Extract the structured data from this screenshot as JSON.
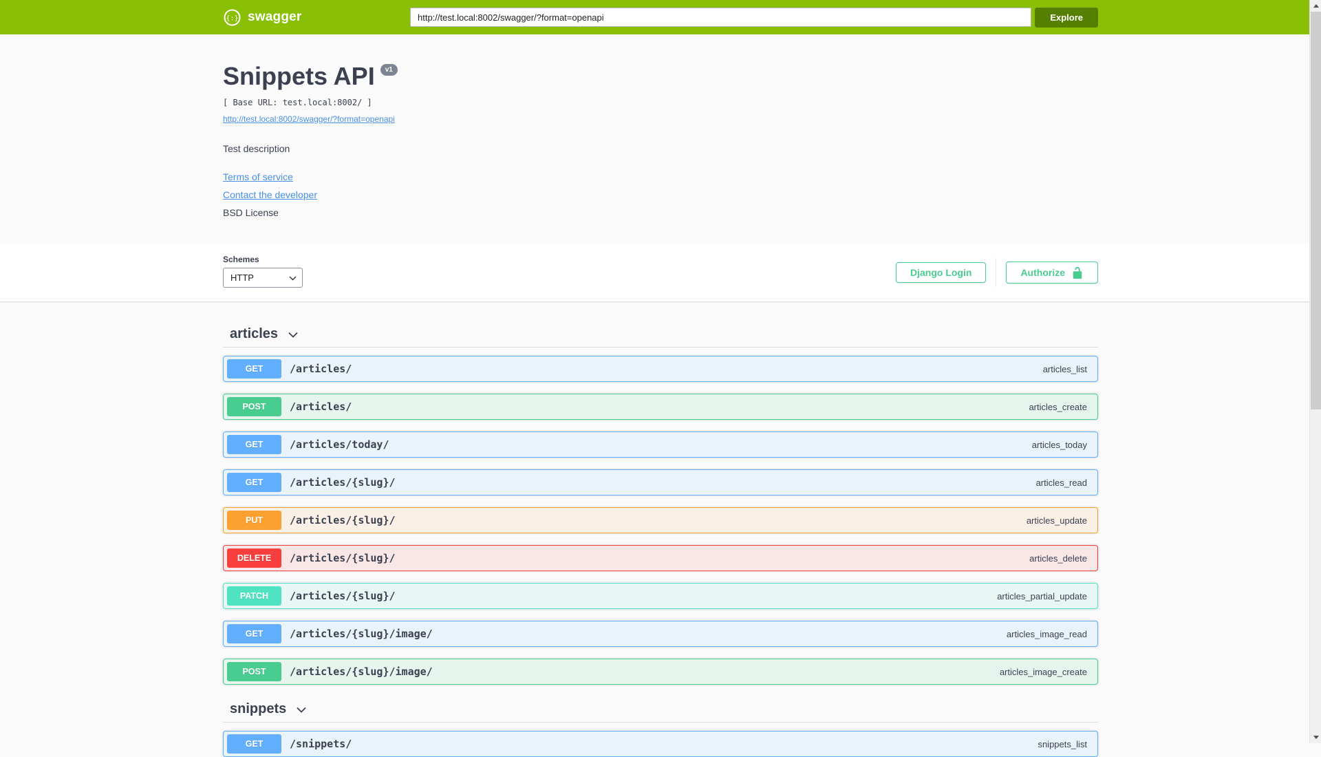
{
  "topbar": {
    "logo_text": "swagger",
    "url_value": "http://test.local:8002/swagger/?format=openapi",
    "explore_label": "Explore"
  },
  "info": {
    "title": "Snippets API",
    "version_badge": "v1",
    "base_url": "[ Base URL: test.local:8002/ ]",
    "spec_link": "http://test.local:8002/swagger/?format=openapi",
    "description": "Test description",
    "terms_link": "Terms of service",
    "contact_link": "Contact the developer",
    "license": "BSD License"
  },
  "scheme": {
    "label": "Schemes",
    "selected": "HTTP",
    "django_login_label": "Django Login",
    "authorize_label": "Authorize"
  },
  "colors": {
    "topbar_bg": "#89bf04",
    "explore_button_bg": "#547f00",
    "link": "#4990e2",
    "text": "#3b4151",
    "authorize": "#49cc90",
    "version_badge_bg": "#7d8492",
    "methods": {
      "GET": "#61affe",
      "POST": "#49cc90",
      "PUT": "#fca130",
      "DELETE": "#f93e3e",
      "PATCH": "#50e3c2"
    }
  },
  "sections": [
    {
      "tag": "articles",
      "operations": [
        {
          "method": "GET",
          "path": "/articles/",
          "operation_id": "articles_list"
        },
        {
          "method": "POST",
          "path": "/articles/",
          "operation_id": "articles_create"
        },
        {
          "method": "GET",
          "path": "/articles/today/",
          "operation_id": "articles_today"
        },
        {
          "method": "GET",
          "path": "/articles/{slug}/",
          "operation_id": "articles_read"
        },
        {
          "method": "PUT",
          "path": "/articles/{slug}/",
          "operation_id": "articles_update"
        },
        {
          "method": "DELETE",
          "path": "/articles/{slug}/",
          "operation_id": "articles_delete"
        },
        {
          "method": "PATCH",
          "path": "/articles/{slug}/",
          "operation_id": "articles_partial_update"
        },
        {
          "method": "GET",
          "path": "/articles/{slug}/image/",
          "operation_id": "articles_image_read"
        },
        {
          "method": "POST",
          "path": "/articles/{slug}/image/",
          "operation_id": "articles_image_create"
        }
      ]
    },
    {
      "tag": "snippets",
      "operations": [
        {
          "method": "GET",
          "path": "/snippets/",
          "operation_id": "snippets_list"
        }
      ]
    }
  ]
}
